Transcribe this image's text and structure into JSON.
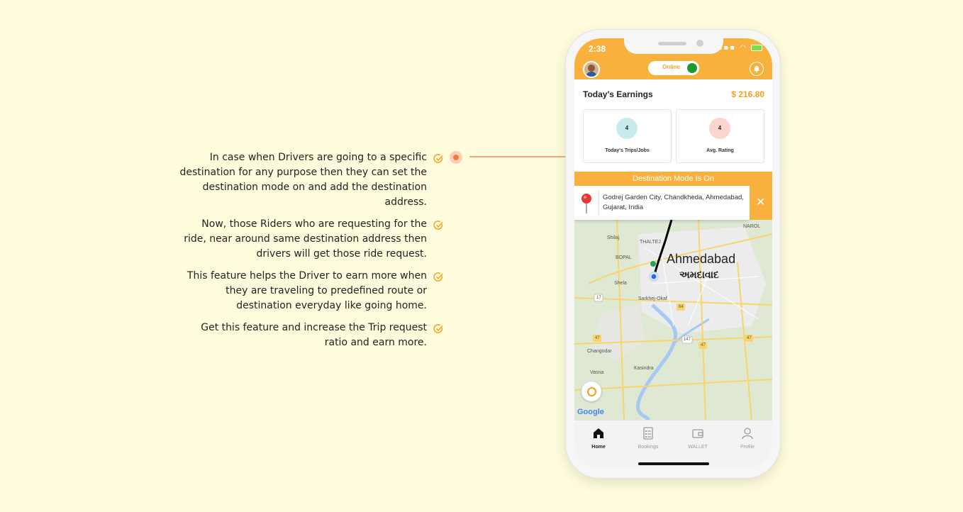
{
  "features": [
    {
      "text": "In case when Drivers are going to a specific destination for any purpose then they can set the destination mode on and add the destination address."
    },
    {
      "text": "Now, those Riders who are requesting for the ride, near around same destination address then drivers will get those ride request."
    },
    {
      "text": "This feature helps the Driver to earn more when they are traveling to predefined route or destination everyday like going home."
    },
    {
      "text": "Get this feature and increase the Trip request ratio and earn more."
    }
  ],
  "phone": {
    "status_bar": {
      "time": "2:38"
    },
    "header": {
      "online_label": "Online"
    },
    "earnings": {
      "title": "Today's Earnings",
      "amount": "$ 216.80",
      "stats": [
        {
          "value": "4",
          "label": "Today's Trips/Jobs"
        },
        {
          "value": "4",
          "label": "Avg. Rating"
        }
      ]
    },
    "destination": {
      "banner": "Destination Mode Is On",
      "address": "Godrej Garden City, Chandkheda, Ahmedabad, Gujarat, India",
      "close_symbol": "✕"
    },
    "map": {
      "city_name_en": "Ahmedabad",
      "city_name_gu": "અમદાવાદ",
      "labels": [
        "Shilaj",
        "THALTEJ",
        "BOPAL",
        "Shela",
        "Sarkhej-Okaf",
        "Changodar",
        "Vasna",
        "Kasindra",
        "NAROL"
      ],
      "road_numbers": [
        "17",
        "64",
        "47",
        "47",
        "47",
        "147"
      ],
      "provider": "Google"
    },
    "tabs": [
      {
        "label": "Home",
        "icon": "home-icon",
        "active": true
      },
      {
        "label": "Bookings",
        "icon": "bookings-icon",
        "active": false
      },
      {
        "label": "WALLET",
        "icon": "wallet-icon",
        "active": false
      },
      {
        "label": "Profile",
        "icon": "profile-icon",
        "active": false
      }
    ]
  },
  "colors": {
    "background": "#fffcdd",
    "accent": "#f9b13e",
    "amount": "#f5a01d",
    "online": "#1d9a2e",
    "connector": "#f2a77c"
  }
}
